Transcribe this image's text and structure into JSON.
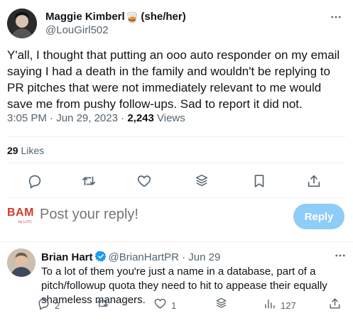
{
  "post": {
    "author_name": "Maggie Kimberl",
    "author_emoji": "🥃",
    "author_pronouns": "(she/her)",
    "author_handle": "@LouGirl502",
    "text": "Y'all, I thought that putting an ooo auto responder on my email saying I had a death in the family and wouldn't be replying to PR pitches that were not immediately relevant to me would save me from pushy follow-ups. Sad to report it did not.",
    "time": "3:05 PM",
    "separator": " · ",
    "date": "Jun 29, 2023",
    "views_count": "2,243",
    "views_label": " Views",
    "likes_count": "29",
    "likes_label": " Likes"
  },
  "actions": [
    "reply-icon",
    "retweet-icon",
    "like-icon",
    "stack-icon",
    "bookmark-icon",
    "share-icon"
  ],
  "composer": {
    "logo_text": "BAM",
    "logo_sub": "by LLYC",
    "placeholder": "Post your reply!",
    "reply_button": "Reply"
  },
  "reply": {
    "author_name": "Brian Hart",
    "author_handle": "@BrianHartPR",
    "separator": " · ",
    "date": "Jun 29",
    "text": "To a lot of them you're just a name in a database, part of a pitch/followup quota they need to hit to appease their equally shameless managers.",
    "reply_count": "2",
    "like_count": "1",
    "view_count": "127"
  },
  "colors": {
    "text_primary": "#0f1419",
    "text_secondary": "#536471",
    "accent": "#1d9bf0",
    "reply_button_disabled": "#8ecdf8",
    "brand_bam": "#d43a2b",
    "divider": "#eff3f4"
  }
}
